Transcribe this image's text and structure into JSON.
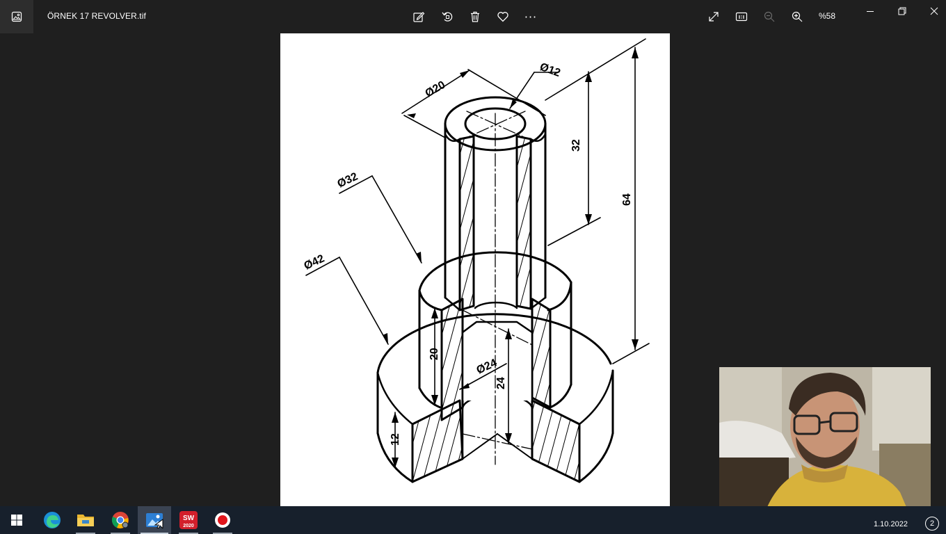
{
  "window": {
    "file_name": "ÖRNEK 17 REVOLVER.tif",
    "zoom_level": "%58"
  },
  "toolbar": {
    "icons": [
      "edit-image-icon",
      "rotate-icon",
      "delete-icon",
      "favorite-icon",
      "more-icon"
    ],
    "more_label": "···"
  },
  "view_controls": {
    "icons": [
      "fullscreen-icon",
      "actual-size-icon",
      "zoom-out-icon",
      "zoom-in-icon"
    ]
  },
  "drawing": {
    "dimensions": {
      "d20": "Ø20",
      "d12": "Ø12",
      "d32": "Ø32",
      "d42": "Ø42",
      "d24": "Ø24",
      "h32": "32",
      "h64": "64",
      "h20": "20",
      "h24": "24",
      "h12": "12"
    }
  },
  "taskbar": {
    "apps": [
      "start-icon",
      "edge-icon",
      "file-explorer-icon",
      "chrome-icon",
      "photos-icon",
      "solidworks-icon",
      "recorder-icon"
    ],
    "solidworks_label": "SW",
    "solidworks_year": "2020",
    "clock": "1.10.2022",
    "notification_count": "2"
  },
  "colors": {
    "background": "#1f1f1f",
    "taskbar": "#17202c",
    "canvas": "#ffffff"
  }
}
